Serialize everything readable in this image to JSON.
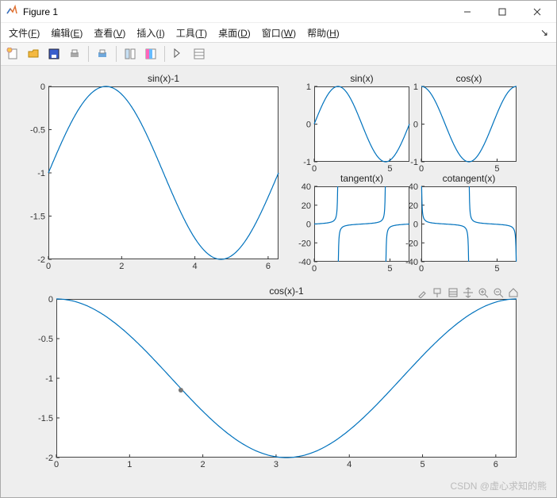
{
  "window": {
    "title": "Figure 1"
  },
  "menubar": {
    "items": [
      {
        "pre": "文件(",
        "u": "F",
        "post": ")"
      },
      {
        "pre": "编辑(",
        "u": "E",
        "post": ")"
      },
      {
        "pre": "查看(",
        "u": "V",
        "post": ")"
      },
      {
        "pre": "插入(",
        "u": "I",
        "post": ")"
      },
      {
        "pre": "工具(",
        "u": "T",
        "post": ")"
      },
      {
        "pre": "桌面(",
        "u": "D",
        "post": ")"
      },
      {
        "pre": "窗口(",
        "u": "W",
        "post": ")"
      },
      {
        "pre": "帮助(",
        "u": "H",
        "post": ")"
      }
    ]
  },
  "watermark": "CSDN @虚心求知的熊",
  "chart_data": [
    {
      "id": "ax1",
      "title": "sin(x)-1",
      "type": "line",
      "xlim": [
        0,
        6.2832
      ],
      "ylim": [
        -2,
        0
      ],
      "xticks": [
        0,
        2,
        4,
        6
      ],
      "yticks": [
        -2,
        -1.5,
        -1,
        -0.5,
        0
      ],
      "series": [
        {
          "name": "sin(x)-1",
          "expr": "sin(x)-1"
        }
      ]
    },
    {
      "id": "ax2",
      "title": "sin(x)",
      "type": "line",
      "xlim": [
        0,
        6.2832
      ],
      "ylim": [
        -1,
        1
      ],
      "xticks": [
        0,
        5
      ],
      "yticks": [
        -1,
        0,
        1
      ],
      "series": [
        {
          "name": "sin(x)",
          "expr": "sin(x)"
        }
      ]
    },
    {
      "id": "ax3",
      "title": "cos(x)",
      "type": "line",
      "xlim": [
        0,
        6.2832
      ],
      "ylim": [
        -1,
        1
      ],
      "xticks": [
        0,
        5
      ],
      "yticks": [
        -1,
        0,
        1
      ],
      "series": [
        {
          "name": "cos(x)",
          "expr": "cos(x)"
        }
      ]
    },
    {
      "id": "ax4",
      "title": "tangent(x)",
      "type": "line",
      "xlim": [
        0,
        6.2832
      ],
      "ylim": [
        -40,
        40
      ],
      "xticks": [
        0,
        5
      ],
      "yticks": [
        -40,
        -20,
        0,
        20,
        40
      ],
      "series": [
        {
          "name": "tan(x)",
          "expr": "tan(x)"
        }
      ]
    },
    {
      "id": "ax5",
      "title": "cotangent(x)",
      "type": "line",
      "xlim": [
        0,
        6.2832
      ],
      "ylim": [
        -40,
        40
      ],
      "xticks": [
        0,
        5
      ],
      "yticks": [
        -40,
        -20,
        0,
        20,
        40
      ],
      "series": [
        {
          "name": "cot(x)",
          "expr": "cot(x)"
        }
      ]
    },
    {
      "id": "ax6",
      "title": "cos(x)-1",
      "type": "line",
      "xlim": [
        0,
        6.2832
      ],
      "ylim": [
        -2,
        0
      ],
      "xticks": [
        0,
        1,
        2,
        3,
        4,
        5,
        6
      ],
      "yticks": [
        -2,
        -1.5,
        -1,
        -0.5,
        0
      ],
      "series": [
        {
          "name": "cos(x)-1",
          "expr": "cos(x)-1"
        }
      ],
      "marker": {
        "x": 1.7,
        "y": -1.15
      }
    }
  ]
}
